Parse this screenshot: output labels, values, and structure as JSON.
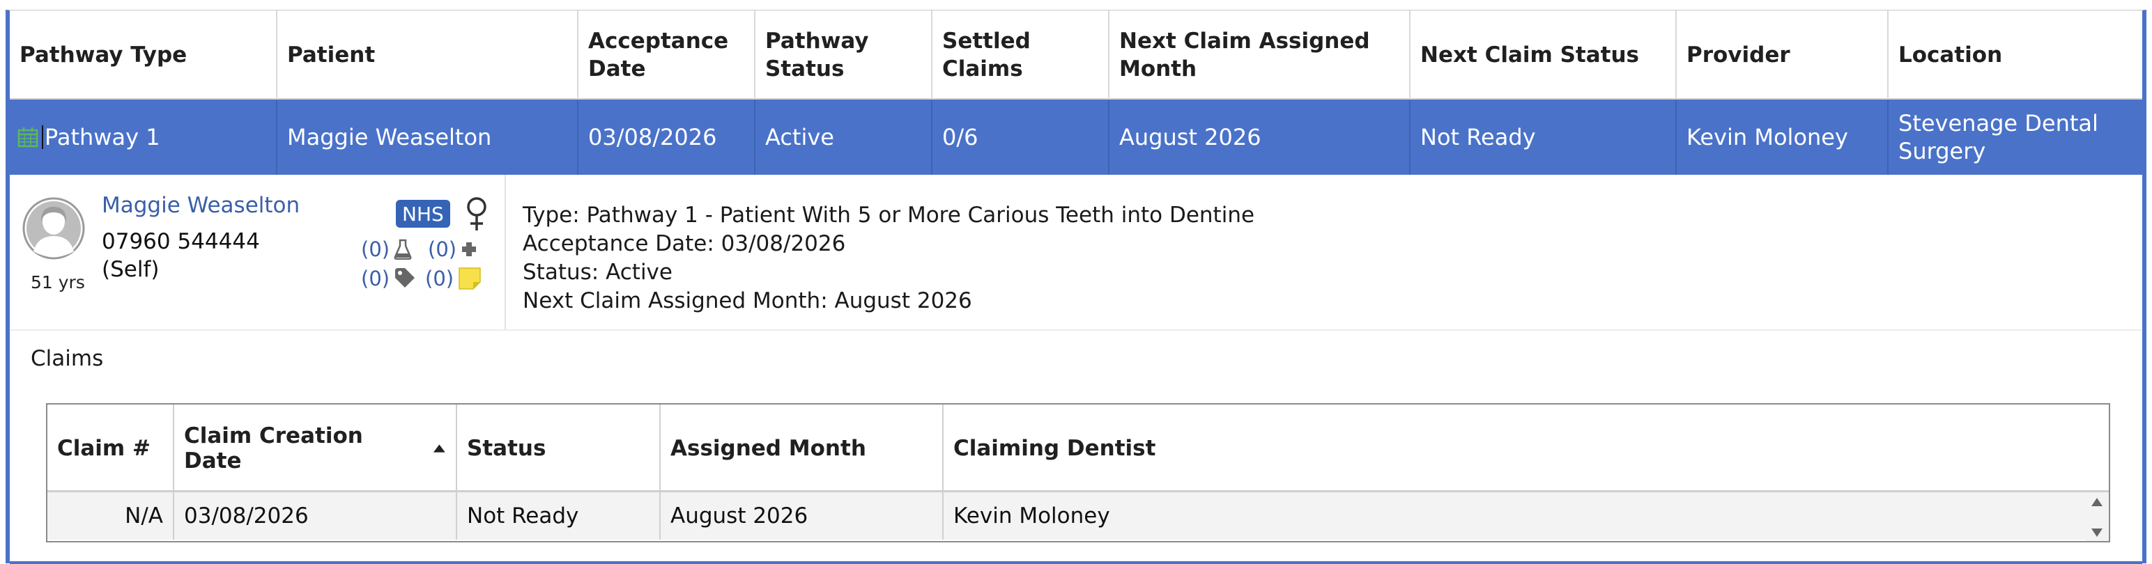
{
  "grid": {
    "columns": [
      "Pathway Type",
      "Patient",
      "Acceptance Date",
      "Pathway Status",
      "Settled Claims",
      "Next Claim Assigned Month",
      "Next Claim Status",
      "Provider",
      "Location"
    ],
    "selected_row": {
      "pathway_type": "Pathway 1",
      "patient": "Maggie Weaselton",
      "acceptance_date": "03/08/2026",
      "pathway_status": "Active",
      "settled_claims": "0/6",
      "next_claim_month": "August 2026",
      "next_claim_status": "Not Ready",
      "provider": "Kevin Moloney",
      "location": "Stevenage Dental Surgery"
    }
  },
  "patient_card": {
    "name": "Maggie Weaselton",
    "phone": "07960 544444",
    "relationship": "(Self)",
    "age": "51 yrs",
    "badge": "NHS",
    "counts": {
      "lab": "(0)",
      "medical": "(0)",
      "tags": "(0)",
      "notes": "(0)"
    }
  },
  "pathway_info": {
    "type_line": "Type: Pathway 1 - Patient With 5 or More Carious Teeth into Dentine",
    "acceptance_line": "Acceptance Date: 03/08/2026",
    "status_line": "Status: Active",
    "next_claim_line": "Next Claim Assigned Month: August 2026"
  },
  "claims": {
    "title": "Claims",
    "columns": [
      "Claim #",
      "Claim Creation Date",
      "Status",
      "Assigned Month",
      "Claiming Dentist"
    ],
    "rows": [
      {
        "claim_no": "N/A",
        "creation_date": "03/08/2026",
        "status": "Not Ready",
        "assigned_month": "August 2026",
        "dentist": "Kevin Moloney"
      }
    ]
  },
  "colors": {
    "accent": "#4a72c9",
    "link": "#3a5ea8",
    "nhs_badge": "#3563b6",
    "note_yellow": "#f7e04a",
    "calendar_green": "#5cb85c"
  },
  "icons": [
    "calendar-icon",
    "avatar-icon",
    "female-icon",
    "flask-icon",
    "plus-icon",
    "tag-icon",
    "note-icon",
    "sort-asc-icon",
    "scroll-up-icon",
    "scroll-down-icon"
  ]
}
